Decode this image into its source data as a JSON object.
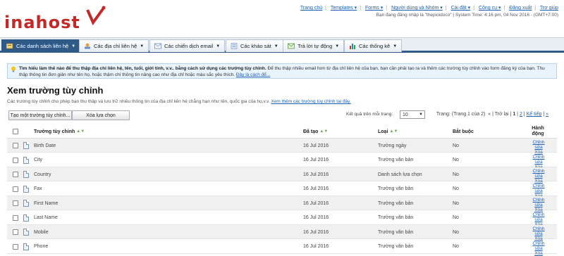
{
  "brand": {
    "logo_text": "inahost",
    "logo_mark": "v",
    "accent": "#c62828"
  },
  "top_links": [
    "Trang chủ",
    "Templates ▾",
    "Forms ▾",
    "Người dùng và Nhóm ▾",
    "Cài đặt ▾",
    "Công cụ ▾",
    "Đăng xuất",
    "Trợ giúp"
  ],
  "user_info": "Bạn đang đăng nhập là \"thepioidoco\" | System Time: 4:16 pm, 04 Nov 2016 - (GMT+7:00)",
  "nav": {
    "tabs": [
      {
        "label": "Các danh sách liên hệ",
        "icon": "contacts-icon"
      },
      {
        "label": "Các địa chỉ liên hệ",
        "icon": "address-icon"
      },
      {
        "label": "Các chiến dịch email",
        "icon": "email-icon"
      },
      {
        "label": "Các khảo sát",
        "icon": "survey-icon"
      },
      {
        "label": "Trả lời tự động",
        "icon": "autoresponder-icon"
      },
      {
        "label": "Các thống kê",
        "icon": "stats-icon"
      }
    ]
  },
  "info": {
    "bold": "Tìm hiểu làm thế nào để thu thập địa chỉ liên hệ, tên, tuổi, giới tính, v.v.. bằng cách sử dụng các trường tùy chỉnh.",
    "text": " Để thu thập nhiều email hơn từ địa chỉ liên hệ của bạn, bạn cần phải tạo ra và thêm các trường tùy chỉnh vào form đăng ký của bạn. Thu thập thông tin đơn giản như tên họ, hoặc thậm chí thông tin nâng cao như địa chỉ hoặc màu sắc yêu thích.",
    "link": "Đây là cách để..."
  },
  "page": {
    "title": "Xem trường tùy chỉnh",
    "desc": "Các trường tùy chỉnh cho phép bạn thu thập và lưu trữ nhiều thông tin của địa chỉ liên hệ chẳng hạn như tên, quốc gia của họ,v.v.",
    "desc_link": "Xem thêm các trường tùy chỉnh tại đây."
  },
  "toolbar": {
    "create": "Tạo một trường tùy chỉnh...",
    "delete": "Xóa lựa chọn",
    "per_page_label": "Kết quả trên mỗi trang:",
    "per_page_value": "10"
  },
  "pager": {
    "prefix": "Trang: (Trang 1 của 2)",
    "back": "« | Trở lại |",
    "p1": "1",
    "p2": "2",
    "next": "Kế tiếp",
    "last": "»"
  },
  "table": {
    "headers": {
      "name": "Trường tùy chỉnh",
      "date": "Đã tạo",
      "type": "Loại",
      "required": "Bắt buộc",
      "action": "Hành động"
    },
    "edit": "Chỉnh sửa",
    "delete": "Xóa",
    "rows": [
      {
        "name": "Birth Date",
        "date": "16 Jul 2016",
        "type": "Trường ngày",
        "required": "No"
      },
      {
        "name": "City",
        "date": "16 Jul 2016",
        "type": "Trường văn bản",
        "required": "No"
      },
      {
        "name": "Country",
        "date": "16 Jul 2016",
        "type": "Danh sách lựa chọn",
        "required": "No"
      },
      {
        "name": "Fax",
        "date": "16 Jul 2016",
        "type": "Trường văn bản",
        "required": "No"
      },
      {
        "name": "First Name",
        "date": "16 Jul 2016",
        "type": "Trường văn bản",
        "required": "No"
      },
      {
        "name": "Last Name",
        "date": "16 Jul 2016",
        "type": "Trường văn bản",
        "required": "No"
      },
      {
        "name": "Mobile",
        "date": "16 Jul 2016",
        "type": "Trường văn bản",
        "required": "No"
      },
      {
        "name": "Phone",
        "date": "16 Jul 2016",
        "type": "Trường văn bản",
        "required": "No"
      }
    ]
  }
}
